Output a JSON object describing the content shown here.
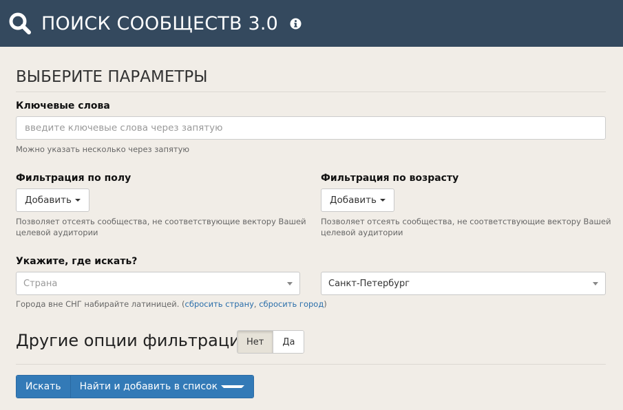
{
  "header": {
    "title": "ПОИСК СООБЩЕСТВ 3.0"
  },
  "params": {
    "title": "ВЫБЕРИТЕ ПАРАМЕТРЫ"
  },
  "keywords": {
    "label": "Ключевые слова",
    "placeholder": "введите ключевые слова через запятую",
    "value": "",
    "help": "Можно указать несколько через запятую"
  },
  "gender_filter": {
    "label": "Фильтрация по полу",
    "button": "Добавить",
    "help_line1": "Позволяет отсеять сообщества, не соответствующие вектору Вашей",
    "help_line2": "целевой аудитории"
  },
  "age_filter": {
    "label": "Фильтрация по возрасту",
    "button": "Добавить",
    "help_line1": "Позволяет отсеять сообщества, не соответствующие вектору Вашей",
    "help_line2": "целевой аудитории"
  },
  "location": {
    "label": "Укажите, где искать?",
    "country_placeholder": "Страна",
    "city_value": "Санкт-Петербург",
    "help_prefix": "Города вне СНГ набирайте латиницей. (",
    "reset_country": "сбросить страну",
    "separator": ", ",
    "reset_city": "сбросить город",
    "help_suffix": ")"
  },
  "other_options": {
    "title": "Другие опции фильтрации",
    "no_label": "Нет",
    "yes_label": "Да",
    "selected": "Нет"
  },
  "actions": {
    "search": "Искать",
    "find_and_add": "Найти и добавить в список"
  },
  "colors": {
    "header_bg": "#34495e",
    "page_bg": "#f1ede7",
    "primary": "#337ab7",
    "link": "#2a6eaa"
  },
  "icons": {
    "header_left": "search-icon",
    "header_info": "info-icon"
  }
}
